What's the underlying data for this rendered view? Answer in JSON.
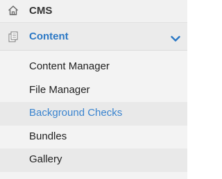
{
  "cms": {
    "label": "CMS",
    "icon": "home-icon"
  },
  "content_section": {
    "label": "Content",
    "icon": "documents-icon",
    "expanded": true,
    "accent_color": "#2b78c5"
  },
  "items": [
    {
      "label": "Content Manager",
      "active": false
    },
    {
      "label": "File Manager",
      "active": false
    },
    {
      "label": "Background Checks",
      "active": true
    },
    {
      "label": "Bundles",
      "active": false
    },
    {
      "label": "Gallery",
      "active": false
    }
  ]
}
